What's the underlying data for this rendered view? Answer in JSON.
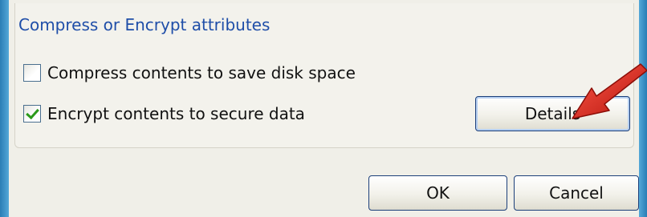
{
  "group": {
    "title": "Compress or Encrypt attributes"
  },
  "options": {
    "compress": {
      "label": "Compress contents to save disk space",
      "checked": false
    },
    "encrypt": {
      "label": "Encrypt contents to secure data",
      "checked": true
    }
  },
  "buttons": {
    "details_label": "Details",
    "ok_label": "OK",
    "cancel_label": "Cancel"
  },
  "colors": {
    "window_frame": "#3a8fc4",
    "dialog_background": "#f0efe8",
    "group_title": "#1f4ea8",
    "checkmark": "#2b9a1a",
    "annotation_arrow": "#d9241c"
  },
  "icons": {
    "checkmark": "check-icon",
    "annotation": "red-arrow-icon"
  }
}
